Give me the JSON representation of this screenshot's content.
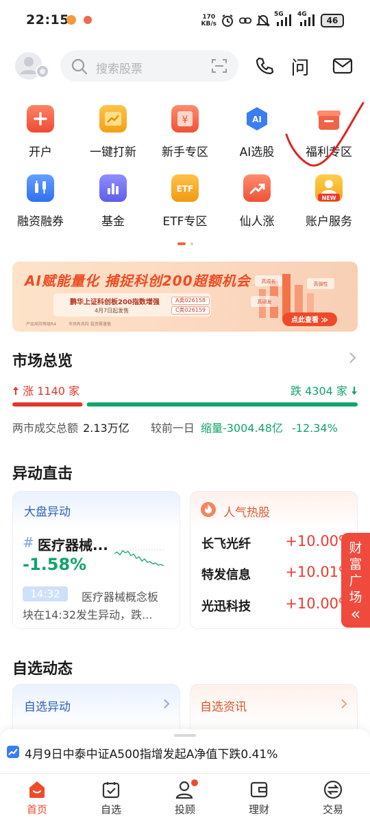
{
  "status_bar": {
    "time": "22:15",
    "net_speed_value": "170",
    "net_speed_unit": "KB/s",
    "signal_1": "5G",
    "signal_2": "4G",
    "battery": "46"
  },
  "header": {
    "search_placeholder": "搜索股票",
    "help_label": "问"
  },
  "quick_actions": [
    {
      "label": "开户",
      "icon": "open-account-icon",
      "color": "#ef5a3c"
    },
    {
      "label": "一键打新",
      "icon": "ipo-icon",
      "color": "#f6a91c"
    },
    {
      "label": "新手专区",
      "icon": "beginner-icon",
      "color": "#ef5a3c"
    },
    {
      "label": "AI选股",
      "icon": "ai-icon",
      "color": "#3b7df3",
      "icon_text": "AI"
    },
    {
      "label": "福利专区",
      "icon": "gift-icon",
      "color": "#f06347"
    },
    {
      "label": "融资融券",
      "icon": "margin-icon",
      "color": "#3b7df3"
    },
    {
      "label": "基金",
      "icon": "fund-icon",
      "color": "#6b6ef0"
    },
    {
      "label": "ETF专区",
      "icon": "etf-icon",
      "color": "#f6a91c",
      "icon_text": "ETF"
    },
    {
      "label": "仙人涨",
      "icon": "rise-icon",
      "color": "#ef5a3c"
    },
    {
      "label": "账户服务",
      "icon": "account-icon",
      "color": "#f6a91c",
      "icon_text": "NEW"
    }
  ],
  "banner": {
    "title": "AI赋能量化 捕捉科创200超额机会",
    "fund_name": "鹏华上证科创板200指数增强",
    "class_a": "A类026158",
    "class_c": "C类026159",
    "date_text": "4月7日起发售",
    "risk_note": "产品风险等级R4",
    "risk_note_2": "市场有风险 投资需谨慎",
    "cta": "点此查看 ≫",
    "chip_1": "高成长",
    "chip_2": "高弹性",
    "chip_3": "高研发"
  },
  "market_overview": {
    "title": "市场总览",
    "rise_label": "涨",
    "rise_count": "1140",
    "fall_label": "跌",
    "fall_count": "4304",
    "unit": "家",
    "rise_ratio": 0.2094,
    "turnover_label": "两市成交总额",
    "turnover_value": "2.13万亿",
    "compare_label": "较前一日",
    "change_label": "缩量",
    "change_value": "-3004.48亿",
    "change_pct": "-12.34%",
    "color_up": "#e5352b",
    "color_down": "#11a56a"
  },
  "alerts": {
    "title": "异动直击",
    "market_card": {
      "header": "大盘异动",
      "sector": "医疗器械...",
      "change": "-1.58%",
      "time_badge": "14:32",
      "desc_line1": "医疗器械概念板",
      "desc_line2": "块在14:32发生异动，跌..."
    },
    "hot_card": {
      "header": "人气热股",
      "stocks": [
        {
          "name": "长飞光纤",
          "change": "+10.00%"
        },
        {
          "name": "特发信息",
          "change": "+10.01%"
        },
        {
          "name": "光迅科技",
          "change": "+10.00%"
        }
      ]
    }
  },
  "side_tab": {
    "label_1": "财",
    "label_2": "富",
    "label_3": "广",
    "label_4": "场",
    "arrow": "«"
  },
  "watchlist": {
    "title": "自选动态",
    "left_card": "自选异动",
    "right_card": "自选资讯"
  },
  "ticker": {
    "text": "4月9日中泰中证A500指增发起A净值下跌0.41%"
  },
  "tabbar": {
    "items": [
      {
        "label": "首页",
        "icon": "home-icon",
        "active": true
      },
      {
        "label": "自选",
        "icon": "watchlist-icon",
        "active": false
      },
      {
        "label": "投顾",
        "icon": "advisor-icon",
        "active": false,
        "badge": true
      },
      {
        "label": "理财",
        "icon": "wealth-icon",
        "active": false
      },
      {
        "label": "交易",
        "icon": "trade-icon",
        "active": false
      }
    ],
    "active_color": "#ef4a2b"
  }
}
